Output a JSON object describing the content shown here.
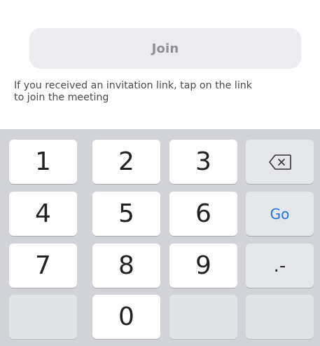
{
  "join": {
    "label": "Join",
    "hint_line1": "If you received an invitation link, tap on the link",
    "hint_line2": "to join the meeting"
  },
  "keypad": {
    "row1": [
      "1",
      "2",
      "3"
    ],
    "row2": [
      "4",
      "5",
      "6"
    ],
    "row3": [
      "7",
      "8",
      "9"
    ],
    "zero": "0",
    "go_label": "Go",
    "dot_dash_label": ".-",
    "backspace_icon": "backspace-icon"
  },
  "colors": {
    "join_bg": "#ebebf0",
    "join_text": "#8f8f99",
    "keypad_bg": "#d1d3d9",
    "go_accent": "#1a73e8"
  }
}
